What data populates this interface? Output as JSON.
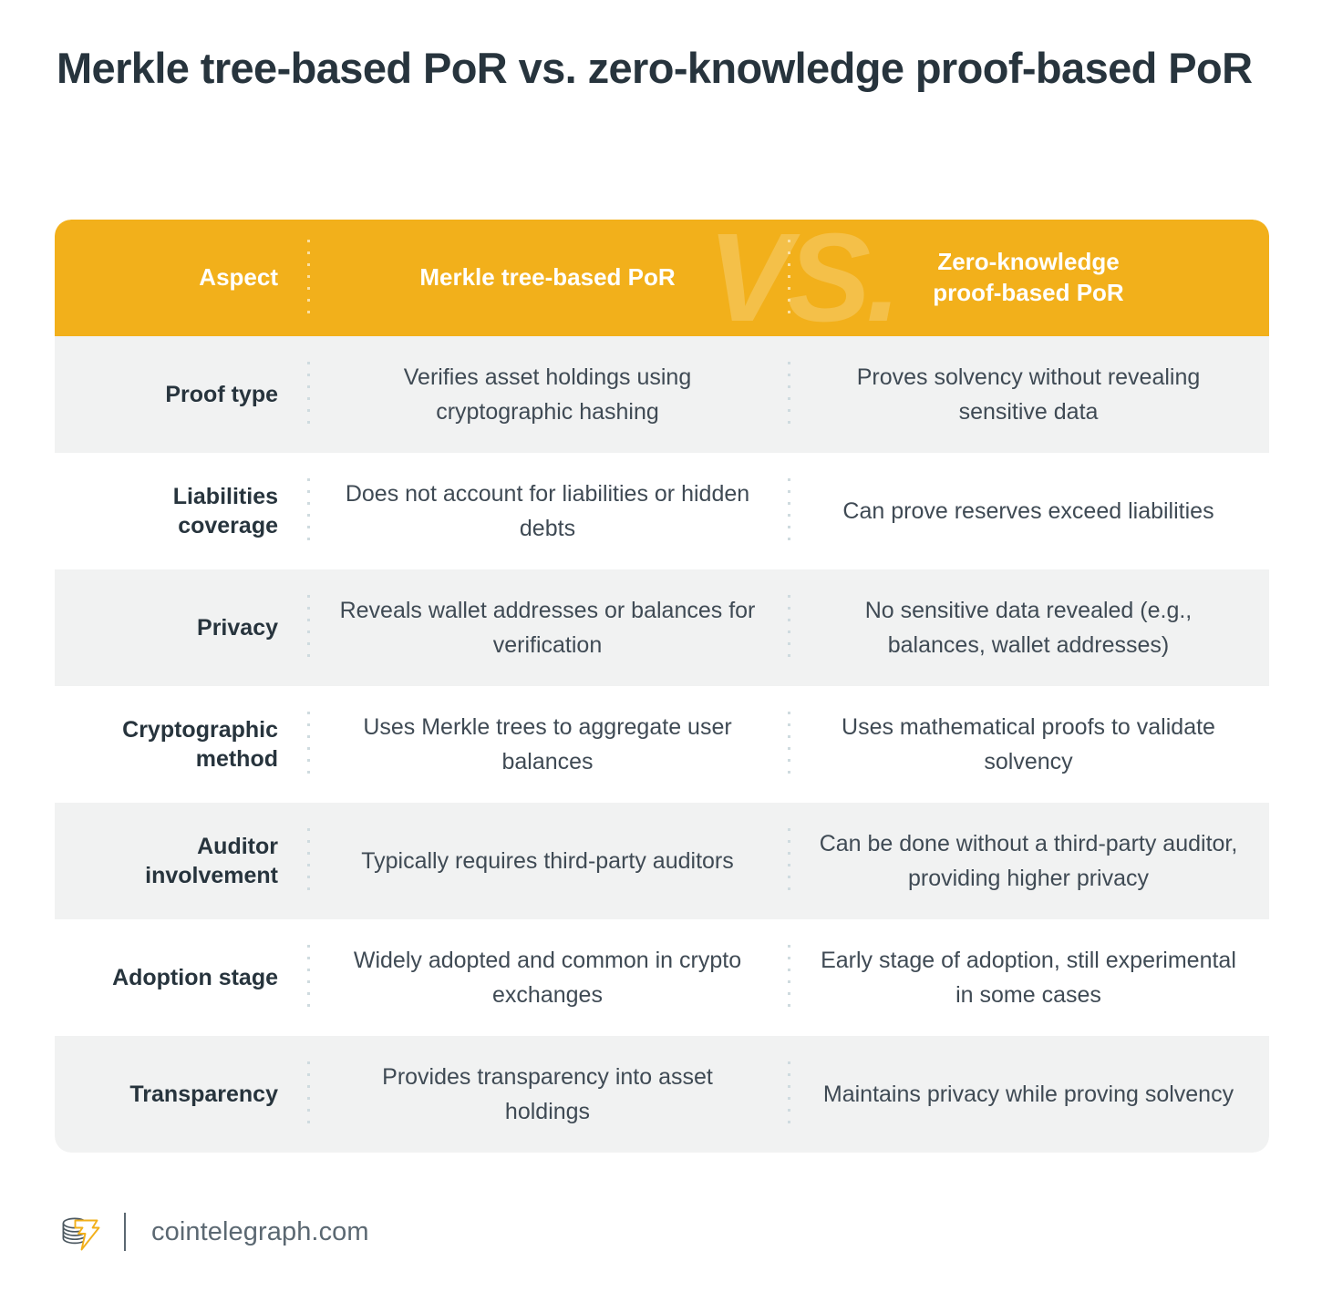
{
  "page_title": "Merkle tree-based PoR vs. zero-knowledge proof-based PoR",
  "colors": {
    "header_bg": "#f2b01b",
    "row_odd_bg": "#f1f2f2",
    "row_even_bg": "#ffffff",
    "title_text": "#27343d",
    "body_text": "#3f4a54",
    "divider_dot": "#cfdbdf",
    "logo_accent": "#f2b01b",
    "footer_text": "#5b6872"
  },
  "table": {
    "watermark": "VS.",
    "headers": {
      "aspect": "Aspect",
      "col_a": "Merkle tree-based PoR",
      "col_b_line1": "Zero-knowledge",
      "col_b_line2": "proof-based PoR"
    },
    "rows": [
      {
        "aspect": "Proof type",
        "col_a": "Verifies asset holdings using cryptographic hashing",
        "col_b": "Proves solvency without revealing sensitive data"
      },
      {
        "aspect": "Liabilities coverage",
        "col_a": "Does not account for liabilities or hidden debts",
        "col_b": "Can prove reserves exceed liabilities"
      },
      {
        "aspect": "Privacy",
        "col_a": "Reveals wallet addresses or balances for verification",
        "col_b": "No sensitive data revealed (e.g., balances, wallet addresses)"
      },
      {
        "aspect": "Cryptographic method",
        "col_a": "Uses Merkle trees to aggregate user balances",
        "col_b": "Uses mathematical proofs to validate solvency"
      },
      {
        "aspect": "Auditor involvement",
        "col_a": "Typically requires third-party auditors",
        "col_b": "Can be done without a third-party auditor, providing higher privacy"
      },
      {
        "aspect": "Adoption stage",
        "col_a": "Widely adopted and common in crypto exchanges",
        "col_b": "Early stage of adoption, still experimental in some cases"
      },
      {
        "aspect": "Transparency",
        "col_a": "Provides transparency into asset holdings",
        "col_b": "Maintains privacy while proving solvency"
      }
    ]
  },
  "footer": {
    "logo_icon": "cointelegraph-coins-bolt-icon",
    "site": "cointelegraph.com"
  }
}
